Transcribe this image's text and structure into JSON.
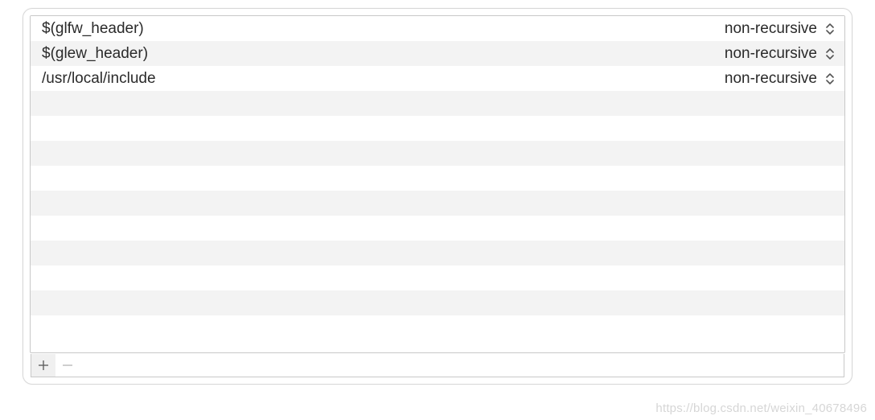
{
  "rows": [
    {
      "path": "$(glfw_header)",
      "mode": "non-recursive"
    },
    {
      "path": "$(glew_header)",
      "mode": "non-recursive"
    },
    {
      "path": "/usr/local/include",
      "mode": "non-recursive"
    }
  ],
  "total_visual_rows": 13,
  "watermark": "https://blog.csdn.net/weixin_40678496"
}
